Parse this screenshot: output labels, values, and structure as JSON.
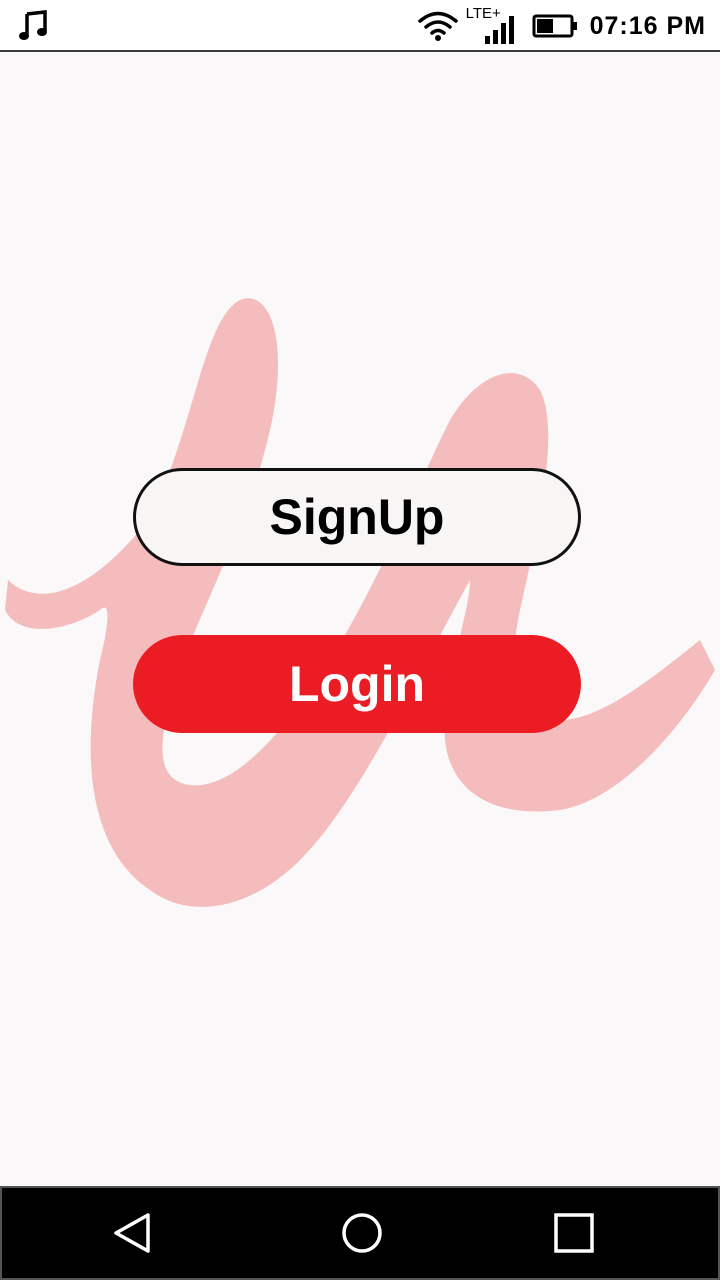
{
  "status_bar": {
    "left_icon": "music-note-icon",
    "network_label": "LTE+",
    "icons": [
      "wifi-icon",
      "signal-icon",
      "battery-icon"
    ],
    "time": "07:16 PM"
  },
  "background_logo": {
    "icon": "brand-logo-icon",
    "color": "#f4bcbc"
  },
  "buttons": {
    "signup_label": "SignUp",
    "login_label": "Login"
  },
  "colors": {
    "login_bg": "#ec1c24",
    "signup_bg": "#f8f6f5",
    "page_bg": "#faf8f9"
  },
  "nav_bar": {
    "icons": [
      "back-icon",
      "home-icon",
      "recents-icon"
    ]
  }
}
